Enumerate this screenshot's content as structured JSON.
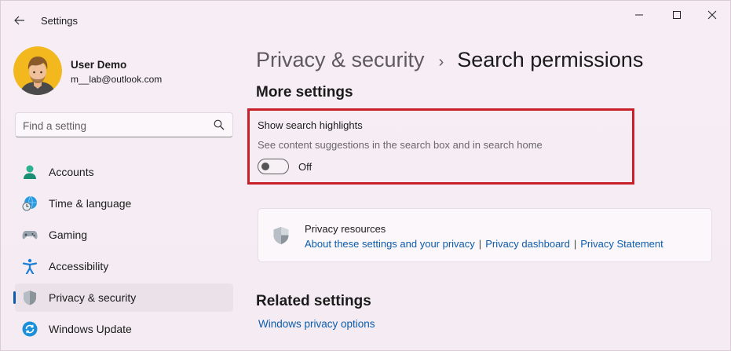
{
  "window": {
    "title": "Settings"
  },
  "profile": {
    "name": "User Demo",
    "email": "m__lab@outlook.com"
  },
  "search": {
    "placeholder": "Find a setting"
  },
  "sidebar": {
    "items": [
      {
        "label": "Accounts",
        "icon": "accounts-icon"
      },
      {
        "label": "Time & language",
        "icon": "time-language-icon"
      },
      {
        "label": "Gaming",
        "icon": "gaming-icon"
      },
      {
        "label": "Accessibility",
        "icon": "accessibility-icon"
      },
      {
        "label": "Privacy & security",
        "icon": "privacy-shield-icon",
        "selected": true
      },
      {
        "label": "Windows Update",
        "icon": "windows-update-icon"
      }
    ]
  },
  "breadcrumb": {
    "parent": "Privacy & security",
    "separator": "›",
    "current": "Search permissions"
  },
  "more_settings": {
    "title": "More settings",
    "show_search_highlights": {
      "title": "Show search highlights",
      "description": "See content suggestions in the search box and in search home",
      "state": "Off"
    }
  },
  "privacy_resources": {
    "title": "Privacy resources",
    "links": [
      "About these settings and your privacy",
      "Privacy dashboard",
      "Privacy Statement"
    ],
    "separator": "|"
  },
  "related_settings": {
    "title": "Related settings",
    "link": "Windows privacy options"
  },
  "colors": {
    "accent": "#0b5cad",
    "highlight_border": "#c8202b",
    "background": "#f3eaf1"
  }
}
